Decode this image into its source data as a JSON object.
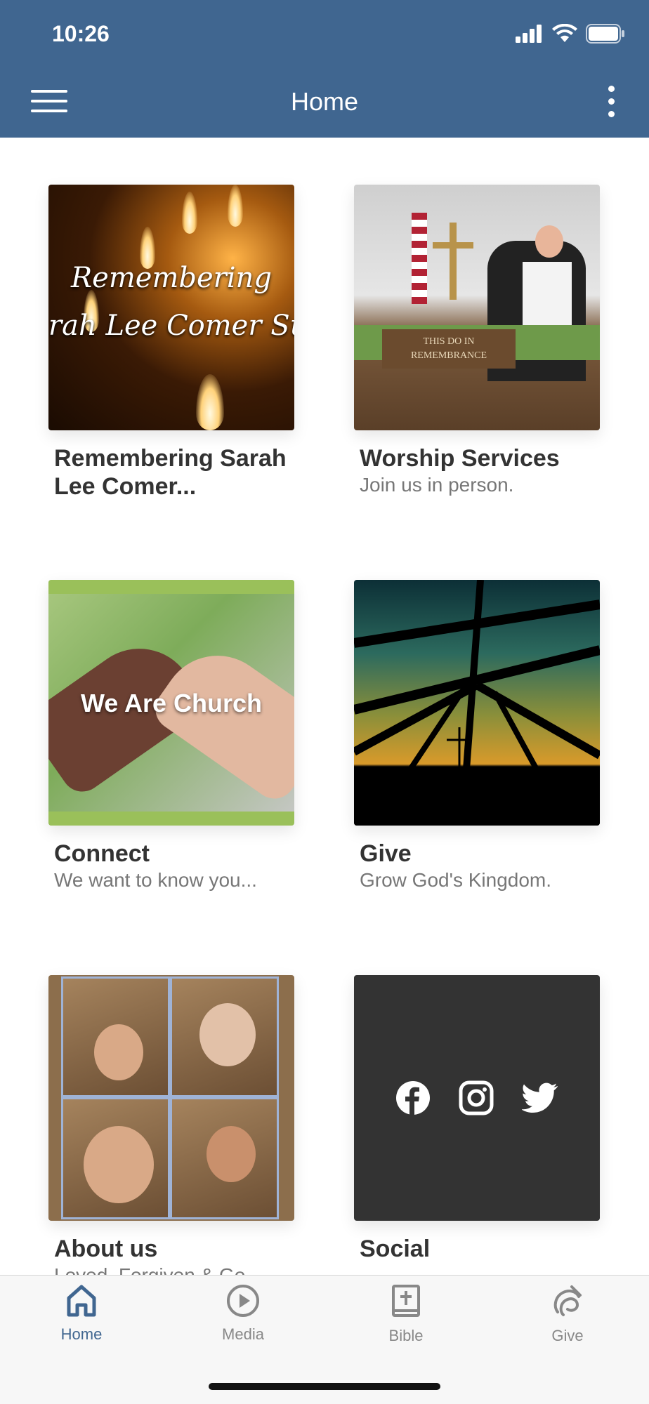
{
  "status_bar": {
    "time": "10:26"
  },
  "header": {
    "title": "Home"
  },
  "cards": [
    {
      "title": "Remembering Sarah Lee Comer...",
      "subtitle": "",
      "thumb_text": "Remembering",
      "thumb_text2": "rah Lee Comer Sut"
    },
    {
      "title": "Worship Services",
      "subtitle": "Join us in person.",
      "thumb_text": "THIS DO IN",
      "thumb_text2": "REMEMBRANCE"
    },
    {
      "title": "Connect",
      "subtitle": "We want to know you...",
      "thumb_text": "We Are Church"
    },
    {
      "title": "Give",
      "subtitle": "Grow God's Kingdom."
    },
    {
      "title": "About us",
      "subtitle": "Loved, Forgiven & Go..."
    },
    {
      "title": "Social",
      "subtitle": "",
      "icons": [
        "facebook-icon",
        "instagram-icon",
        "twitter-icon"
      ]
    }
  ],
  "tabbar": {
    "tabs": [
      {
        "label": "Home",
        "icon": "home-icon",
        "active": true
      },
      {
        "label": "Media",
        "icon": "play-circle-icon",
        "active": false
      },
      {
        "label": "Bible",
        "icon": "bible-icon",
        "active": false
      },
      {
        "label": "Give",
        "icon": "give-icon",
        "active": false
      }
    ]
  },
  "colors": {
    "header": "#406690",
    "active_tab": "#406690",
    "inactive_tab": "#888888",
    "social_bg": "#333333"
  }
}
